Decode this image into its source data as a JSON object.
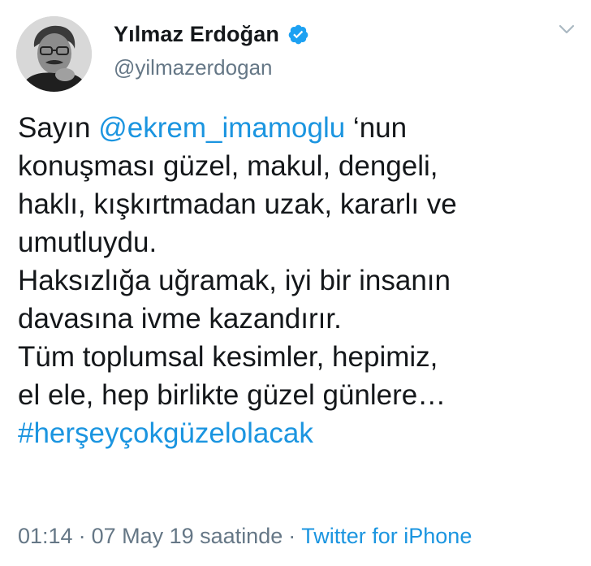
{
  "author": {
    "name": "Yılmaz Erdoğan",
    "handle": "@yilmazerdogan",
    "verified": true,
    "avatar_icon": "person-photo-icon"
  },
  "tweet": {
    "line1": {
      "before": "Sayın ",
      "mention": "@ekrem_imamoglu",
      "after": " ‘nun"
    },
    "line2": "konuşması güzel, makul, dengeli,",
    "line3": "haklı, kışkırtmadan uzak, kararlı ve",
    "line4": "umutluydu.",
    "line5": "Haksızlığa uğramak, iyi bir insanın",
    "line6": "davasına ivme kazandırır.",
    "line7": "Tüm toplumsal kesimler, hepimiz,",
    "line8": "el ele, hep birlikte güzel günlere…",
    "hashtag": "#herşeyçokgüzelolacak"
  },
  "meta": {
    "time": "01:14",
    "separator": "·",
    "date": "07 May 19 saatinde",
    "source": "Twitter for iPhone"
  },
  "colors": {
    "link": "#1b95e0",
    "secondary_text": "#657786",
    "primary_text": "#14171a",
    "verified": "#1da1f2"
  },
  "icons": {
    "verified": "verified-badge-icon",
    "menu": "chevron-down-icon"
  }
}
